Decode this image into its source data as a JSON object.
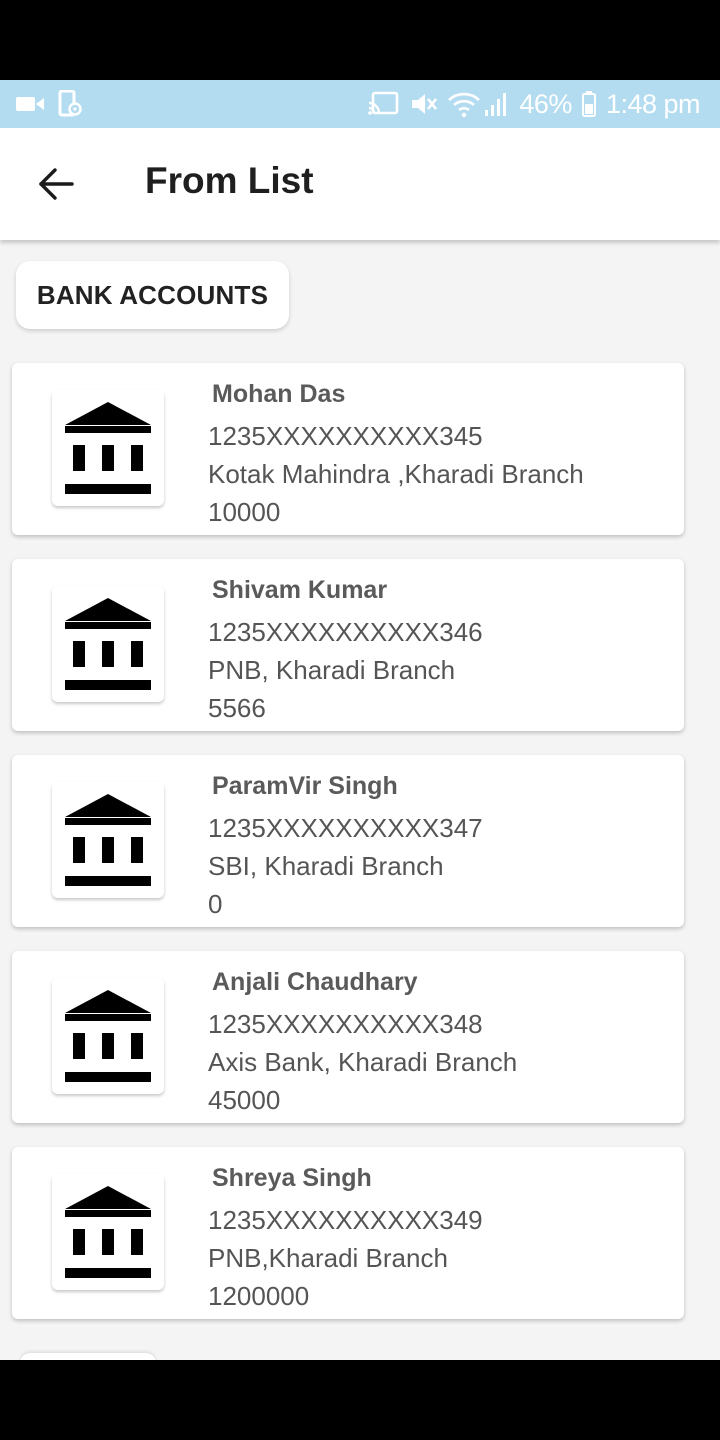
{
  "status_bar": {
    "battery": "46%",
    "time": "1:48 pm"
  },
  "header": {
    "title": "From List",
    "back_icon": "arrow-back-icon"
  },
  "tabs": [
    {
      "label": "BANK ACCOUNTS",
      "selected": true
    }
  ],
  "accounts": [
    {
      "name": "Mohan Das",
      "account_number": "1235XXXXXXXXXX345",
      "bank": "Kotak Mahindra ,Kharadi Branch",
      "balance": "10000",
      "icon": "bank-icon"
    },
    {
      "name": "Shivam Kumar",
      "account_number": "1235XXXXXXXXXX346",
      "bank": "PNB, Kharadi Branch",
      "balance": "5566",
      "icon": "bank-icon"
    },
    {
      "name": "ParamVir Singh",
      "account_number": "1235XXXXXXXXXX347",
      "bank": "SBI, Kharadi Branch",
      "balance": "0",
      "icon": "bank-icon"
    },
    {
      "name": "Anjali Chaudhary",
      "account_number": "1235XXXXXXXXXX348",
      "bank": "Axis Bank, Kharadi Branch",
      "balance": "45000",
      "icon": "bank-icon"
    },
    {
      "name": "Shreya Singh",
      "account_number": "1235XXXXXXXXXX349",
      "bank": "PNB,Kharadi Branch",
      "balance": "1200000",
      "icon": "bank-icon"
    }
  ],
  "colors": {
    "status_bar": "#b3dcf1",
    "background": "#f4f4f4",
    "card": "#ffffff"
  }
}
